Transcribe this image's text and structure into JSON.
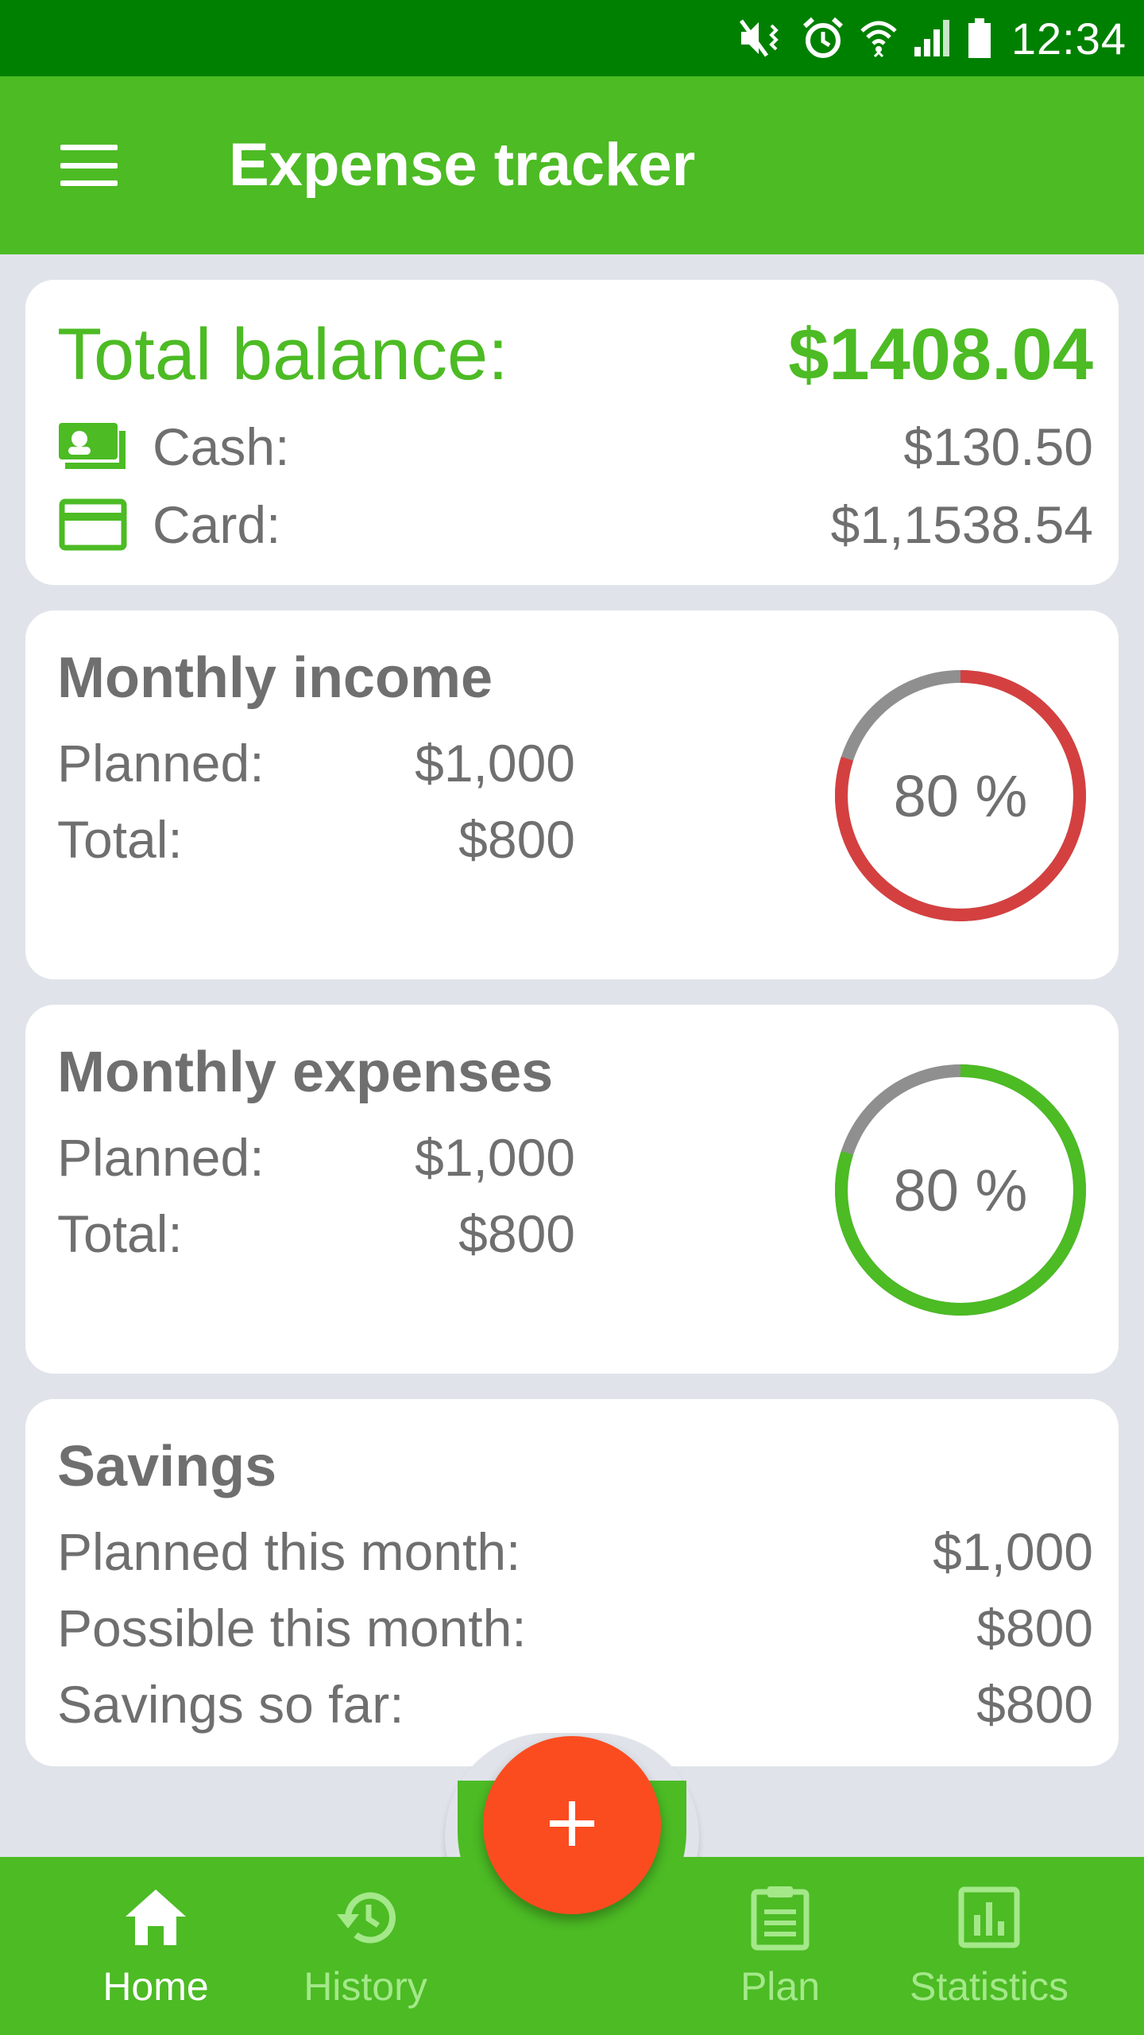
{
  "status_bar": {
    "time": "12:34",
    "icons": [
      "mute-vibrate-icon",
      "alarm-icon",
      "wifi-icon",
      "cell-signal-icon",
      "battery-icon"
    ]
  },
  "app_bar": {
    "title": "Expense tracker",
    "menu_icon": "hamburger-menu-icon"
  },
  "balance": {
    "title": "Total balance:",
    "total": "$1408.04",
    "cash_label": "Cash:",
    "cash_value": "$130.50",
    "card_label": "Card:",
    "card_value": "$1,1538.54",
    "cash_icon": "cash-icon",
    "card_icon": "credit-card-icon"
  },
  "monthly_income": {
    "title": "Monthly income",
    "planned_label": "Planned:",
    "planned_value": "$1,000",
    "total_label": "Total:",
    "total_value": "$800",
    "percent_label": "80 %",
    "percent": 0.8,
    "progress_color": "#d44040"
  },
  "monthly_expenses": {
    "title": "Monthly expenses",
    "planned_label": "Planned:",
    "planned_value": "$1,000",
    "total_label": "Total:",
    "total_value": "$800",
    "percent_label": "80 %",
    "percent": 0.8,
    "progress_color": "#4cbb24"
  },
  "savings": {
    "title": "Savings",
    "rows": [
      {
        "label": "Planned this month:",
        "value": "$1,000"
      },
      {
        "label": "Possible this month:",
        "value": "$800"
      },
      {
        "label": "Savings so far:",
        "value": "$800"
      }
    ]
  },
  "fab": {
    "icon": "plus-icon"
  },
  "bottom_nav": {
    "items": [
      {
        "label": "Home",
        "icon": "home-icon",
        "active": true
      },
      {
        "label": "History",
        "icon": "history-icon",
        "active": false
      },
      {
        "label": "Plan",
        "icon": "clipboard-icon",
        "active": false
      },
      {
        "label": "Statistics",
        "icon": "bar-chart-icon",
        "active": false
      }
    ]
  },
  "colors": {
    "status_bar": "#008000",
    "primary": "#4cbb24",
    "fab": "#fb4c20",
    "ring_track": "#8f8f8f",
    "background": "#e0e4ea"
  }
}
